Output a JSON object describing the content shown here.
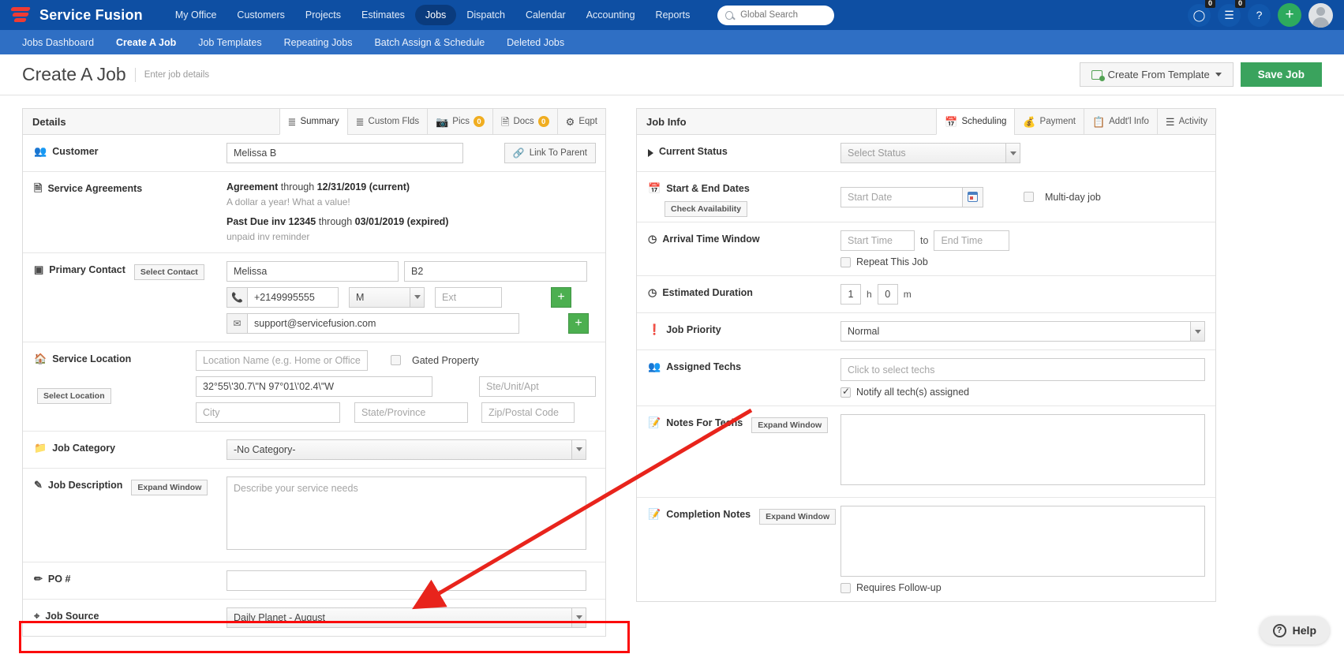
{
  "brand": {
    "name": "Service Fusion"
  },
  "topnav": {
    "items": [
      {
        "label": "My Office",
        "active": false
      },
      {
        "label": "Customers",
        "active": false
      },
      {
        "label": "Projects",
        "active": false
      },
      {
        "label": "Estimates",
        "active": false
      },
      {
        "label": "Jobs",
        "active": true
      },
      {
        "label": "Dispatch",
        "active": false
      },
      {
        "label": "Calendar",
        "active": false
      },
      {
        "label": "Accounting",
        "active": false
      },
      {
        "label": "Reports",
        "active": false
      }
    ],
    "search_placeholder": "Global Search",
    "search_value": "",
    "chat_badge": "0",
    "list_badge": "0",
    "help_glyph": "?",
    "plus_glyph": "+"
  },
  "subnav": {
    "items": [
      {
        "label": "Jobs Dashboard",
        "active": false
      },
      {
        "label": "Create A Job",
        "active": true
      },
      {
        "label": "Job Templates",
        "active": false
      },
      {
        "label": "Repeating Jobs",
        "active": false
      },
      {
        "label": "Batch Assign & Schedule",
        "active": false
      },
      {
        "label": "Deleted Jobs",
        "active": false
      }
    ]
  },
  "titlebar": {
    "title": "Create A Job",
    "subtitle": "Enter job details",
    "template_button": "Create From Template",
    "save_button": "Save Job"
  },
  "details": {
    "panel_title": "Details",
    "tabs": [
      {
        "label": "Summary",
        "icon": "list-icon",
        "active": true,
        "count": null
      },
      {
        "label": "Custom Flds",
        "icon": "list-icon",
        "active": false,
        "count": null
      },
      {
        "label": "Pics",
        "icon": "camera-icon",
        "active": false,
        "count": "0"
      },
      {
        "label": "Docs",
        "icon": "document-icon",
        "active": false,
        "count": "0"
      },
      {
        "label": "Eqpt",
        "icon": "equipment-icon",
        "active": false,
        "count": null
      }
    ],
    "customer": {
      "label": "Customer",
      "value": "Melissa B",
      "placeholder": "",
      "link_to_parent": "Link To Parent"
    },
    "service_agreements": {
      "label": "Service Agreements",
      "entries": [
        {
          "name": "Agreement",
          "mid": "through",
          "date": "12/31/2019 (current)",
          "expired": false,
          "note": "A dollar a year! What a value!"
        },
        {
          "name": "Past Due inv 12345",
          "mid": "through",
          "date": "03/01/2019 (expired)",
          "expired": true,
          "note": "unpaid inv reminder"
        }
      ]
    },
    "primary_contact": {
      "label": "Primary Contact",
      "select_button": "Select Contact",
      "first_name": "Melissa",
      "last_name": "B2",
      "phone": "+2149995555",
      "phone_type": "M",
      "ext_placeholder": "Ext",
      "ext_value": "",
      "email": "support@servicefusion.com"
    },
    "service_location": {
      "label": "Service Location",
      "select_button": "Select Location",
      "location_name_placeholder": "Location Name (e.g. Home or Office)",
      "location_name_value": "",
      "gated_property_label": "Gated Property",
      "gated_property_checked": false,
      "street": "32°55\\'30.7\\\"N 97°01\\'02.4\\\"W",
      "ste_placeholder": "Ste/Unit/Apt",
      "ste_value": "",
      "city_placeholder": "City",
      "city_value": "",
      "state_placeholder": "State/Province",
      "state_value": "",
      "zip_placeholder": "Zip/Postal Code",
      "zip_value": ""
    },
    "job_category": {
      "label": "Job Category",
      "value": "-No Category-"
    },
    "job_description": {
      "label": "Job Description",
      "expand_button": "Expand Window",
      "placeholder": "Describe your service needs",
      "value": ""
    },
    "po_number": {
      "label": "PO #",
      "value": "",
      "placeholder": ""
    },
    "job_source": {
      "label": "Job Source",
      "value": "Daily Planet - August",
      "highlighted": true
    }
  },
  "job_info": {
    "panel_title": "Job Info",
    "tabs": [
      {
        "label": "Scheduling",
        "icon": "calendar-icon",
        "active": true
      },
      {
        "label": "Payment",
        "icon": "payment-icon",
        "active": false
      },
      {
        "label": "Addt'l Info",
        "icon": "clipboard-icon",
        "active": false
      },
      {
        "label": "Activity",
        "icon": "activity-icon",
        "active": false
      }
    ],
    "current_status": {
      "label": "Current Status",
      "value": "Select Status"
    },
    "start_end_dates": {
      "label": "Start & End Dates",
      "check_availability": "Check Availability",
      "start_date_placeholder": "Start Date",
      "start_date_value": "",
      "multi_day_label": "Multi-day job",
      "multi_day_checked": false
    },
    "arrival_time_window": {
      "label": "Arrival Time Window",
      "start_time_placeholder": "Start Time",
      "start_time_value": "",
      "to_label": "to",
      "end_time_placeholder": "End Time",
      "end_time_value": "",
      "repeat_label": "Repeat This Job",
      "repeat_checked": false
    },
    "estimated_duration": {
      "label": "Estimated Duration",
      "hours": "1",
      "hours_unit": "h",
      "minutes": "0",
      "minutes_unit": "m"
    },
    "job_priority": {
      "label": "Job Priority",
      "value": "Normal"
    },
    "assigned_techs": {
      "label": "Assigned Techs",
      "placeholder": "Click to select techs",
      "value": "",
      "notify_label": "Notify all tech(s) assigned",
      "notify_checked": true
    },
    "notes_for_techs": {
      "label": "Notes For Techs",
      "expand_button": "Expand Window",
      "value": ""
    },
    "completion_notes": {
      "label": "Completion Notes",
      "expand_button": "Expand Window",
      "value": "",
      "requires_followup_label": "Requires Follow-up",
      "requires_followup_checked": false
    }
  },
  "help_widget": {
    "label": "Help"
  },
  "annotation": {
    "highlight_color": "#fb0b0b",
    "arrow_color": "#e8241c"
  }
}
